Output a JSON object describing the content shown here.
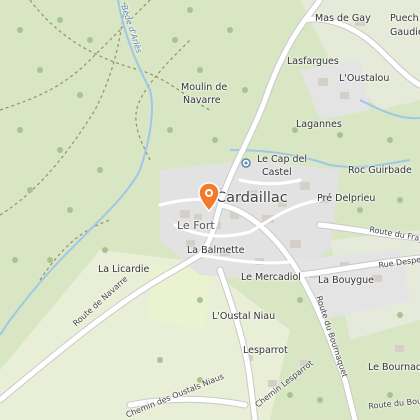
{
  "map": {
    "place_names": {
      "mas_de_gay": "Mas de Gay",
      "puech_gaudie": "Puech",
      "gaudie": "Gaudie",
      "lasfargues": "Lasfargues",
      "oustalou": "L'Oustalou",
      "moulin_1": "Moulin de",
      "moulin_2": "Navarre",
      "lagannes": "Lagannes",
      "cap_1": "Le Cap del",
      "cap_2": "Castel",
      "roc_guirbade": "Roc Guirbade",
      "cardaillac": "Cardaillac",
      "fort": "Le Fort",
      "pre_delprieu": "Pré Delprieu",
      "balmette": "La Balmette",
      "licardie": "La Licardie",
      "mercadiol": "Le Mercadiol",
      "bouygue": "La Bouygue",
      "oustal_niau": "L'Oustal Niau",
      "lesparrot": "Lesparrot",
      "bournaquet": "Le Bournaquet"
    },
    "road_names": {
      "route_navarre": "Route de Navarre",
      "route_bournaquet": "Route du Bournaquet",
      "route_frayssinet": "Route du Fray",
      "rue_despeyroux": "Rue Despey",
      "chemin_oustals": "Chemin des Oustals Niaus",
      "chemin_lesparrot": "Chemin Lesparrot",
      "route_bourna_short": "Route du Bourna"
    },
    "water_names": {
      "bede": "Bède d'Arlès"
    },
    "colors": {
      "forest": "#d8e6c4",
      "meadow": "#e9efd6",
      "residential": "#e2e2e2",
      "building": "#d5cfc7",
      "road": "#ffffff",
      "river": "#9fc7e6",
      "marker": "#f47a2b"
    },
    "icons": {
      "marker": "map-pin-icon",
      "viewpoint": "viewpoint-icon"
    }
  }
}
